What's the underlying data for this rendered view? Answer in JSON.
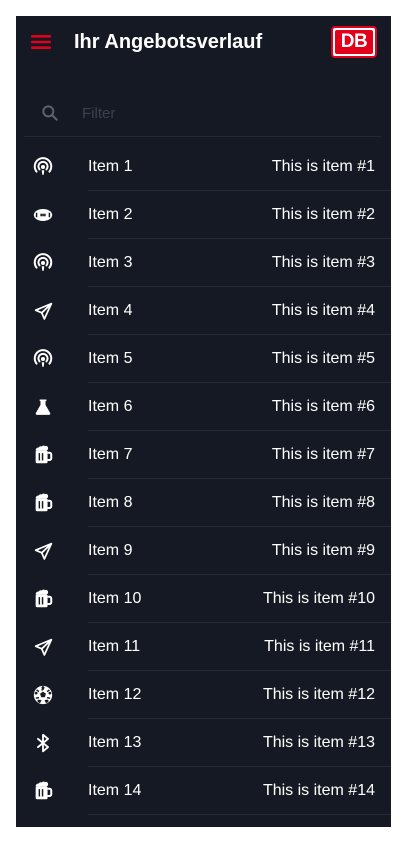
{
  "app": {
    "title": "Ihr Angebotsverlauf",
    "logo_text": "DB",
    "accent_color": "#e3001b",
    "background_color": "#151923"
  },
  "search": {
    "placeholder": "Filter",
    "value": ""
  },
  "items": [
    {
      "label": "Item 1",
      "value": "This is item #1",
      "icon": "podcast-icon"
    },
    {
      "label": "Item 2",
      "value": "This is item #2",
      "icon": "football-icon"
    },
    {
      "label": "Item 3",
      "value": "This is item #3",
      "icon": "podcast-icon"
    },
    {
      "label": "Item 4",
      "value": "This is item #4",
      "icon": "paper-plane-icon"
    },
    {
      "label": "Item 5",
      "value": "This is item #5",
      "icon": "podcast-icon"
    },
    {
      "label": "Item 6",
      "value": "This is item #6",
      "icon": "flask-icon"
    },
    {
      "label": "Item 7",
      "value": "This is item #7",
      "icon": "beer-icon"
    },
    {
      "label": "Item 8",
      "value": "This is item #8",
      "icon": "beer-icon"
    },
    {
      "label": "Item 9",
      "value": "This is item #9",
      "icon": "paper-plane-icon"
    },
    {
      "label": "Item 10",
      "value": "This is item #10",
      "icon": "beer-icon"
    },
    {
      "label": "Item 11",
      "value": "This is item #11",
      "icon": "paper-plane-icon"
    },
    {
      "label": "Item 12",
      "value": "This is item #12",
      "icon": "soccer-ball-icon"
    },
    {
      "label": "Item 13",
      "value": "This is item #13",
      "icon": "bluetooth-icon"
    },
    {
      "label": "Item 14",
      "value": "This is item #14",
      "icon": "beer-icon"
    },
    {
      "label": "",
      "value": "",
      "icon": "beer-icon"
    }
  ]
}
